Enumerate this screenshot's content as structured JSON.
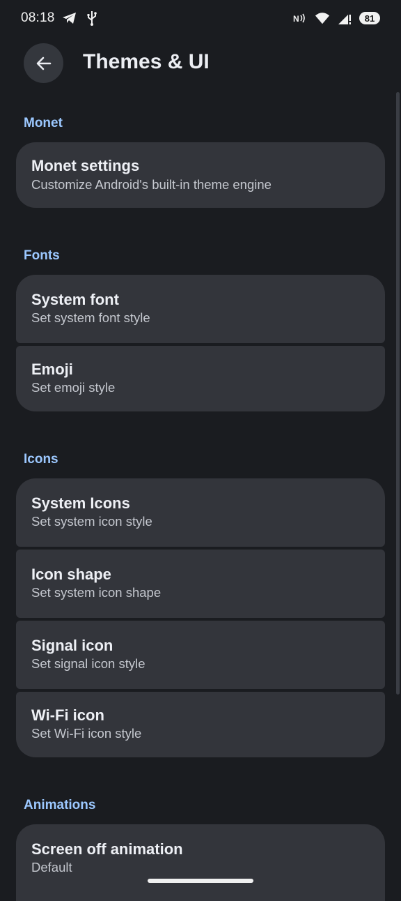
{
  "status_bar": {
    "time": "08:18",
    "battery": "81",
    "left_icons": [
      "telegram-icon",
      "usb-icon"
    ],
    "right_icons": [
      "nfc-icon",
      "wifi-icon",
      "signal-icon",
      "battery-icon"
    ]
  },
  "header": {
    "title": "Themes & UI",
    "back_icon": "back-arrow-icon"
  },
  "sections": {
    "monet": {
      "label": "Monet",
      "items": [
        {
          "title": "Monet settings",
          "subtitle": "Customize Android's built-in theme engine"
        }
      ]
    },
    "fonts": {
      "label": "Fonts",
      "items": [
        {
          "title": "System font",
          "subtitle": "Set system font style"
        },
        {
          "title": "Emoji",
          "subtitle": "Set emoji style"
        }
      ]
    },
    "icons": {
      "label": "Icons",
      "items": [
        {
          "title": "System Icons",
          "subtitle": "Set system icon style"
        },
        {
          "title": "Icon shape",
          "subtitle": "Set system icon shape"
        },
        {
          "title": "Signal icon",
          "subtitle": "Set signal icon style"
        },
        {
          "title": "Wi-Fi icon",
          "subtitle": "Set Wi-Fi icon style"
        }
      ]
    },
    "animations": {
      "label": "Animations",
      "items": [
        {
          "title": "Screen off animation",
          "subtitle": "Default"
        }
      ]
    }
  },
  "colors": {
    "background": "#1a1c20",
    "card": "#33353b",
    "accent": "#9cc8ff"
  }
}
